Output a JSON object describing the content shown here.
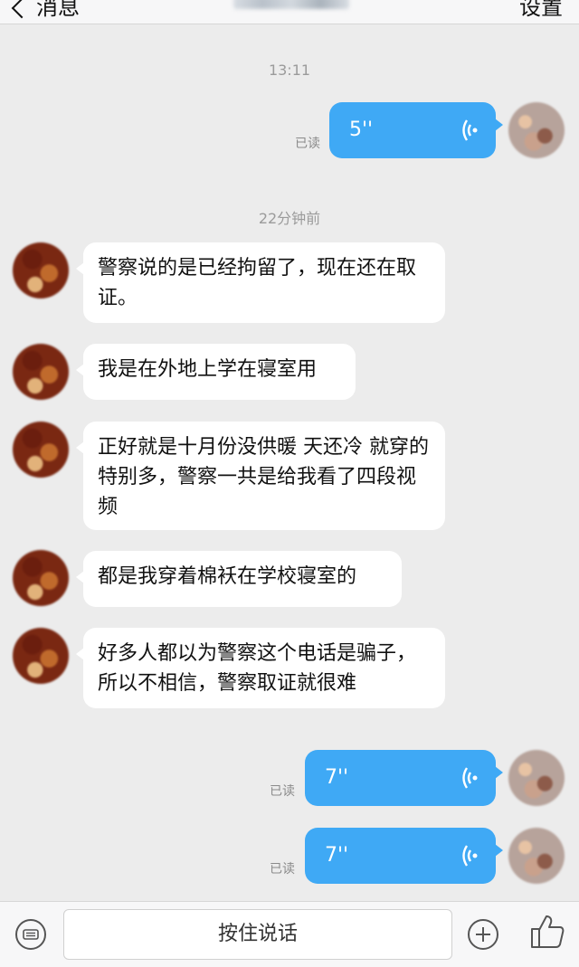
{
  "header": {
    "back_label": "消息",
    "settings_label": "设置"
  },
  "timestamps": [
    "13:11",
    "22分钟前"
  ],
  "messages_out": [
    {
      "duration": "5''",
      "status": "已读"
    },
    {
      "duration": "7''",
      "status": "已读"
    },
    {
      "duration": "7''",
      "status": "已读"
    }
  ],
  "messages_in": [
    {
      "text": "警察说的是已经拘留了，现在还在取证。"
    },
    {
      "text": "我是在外地上学在寝室用"
    },
    {
      "text": "正好就是十月份没供暖 天还冷 就穿的特别多，警察一共是给我看了四段视频"
    },
    {
      "text": "都是我穿着棉袄在学校寝室的"
    },
    {
      "text": "好多人都以为警察这个电话是骗子，所以不相信，警察取证就很难"
    }
  ],
  "bottom_bar": {
    "hold_to_talk": "按住说话",
    "icons": [
      "voice-keyboard-icon",
      "plus-icon",
      "thumbs-up-icon"
    ]
  },
  "colors": {
    "outgoing_bubble": "#3fa9f5",
    "incoming_bubble": "#ffffff",
    "background": "#ececec"
  }
}
